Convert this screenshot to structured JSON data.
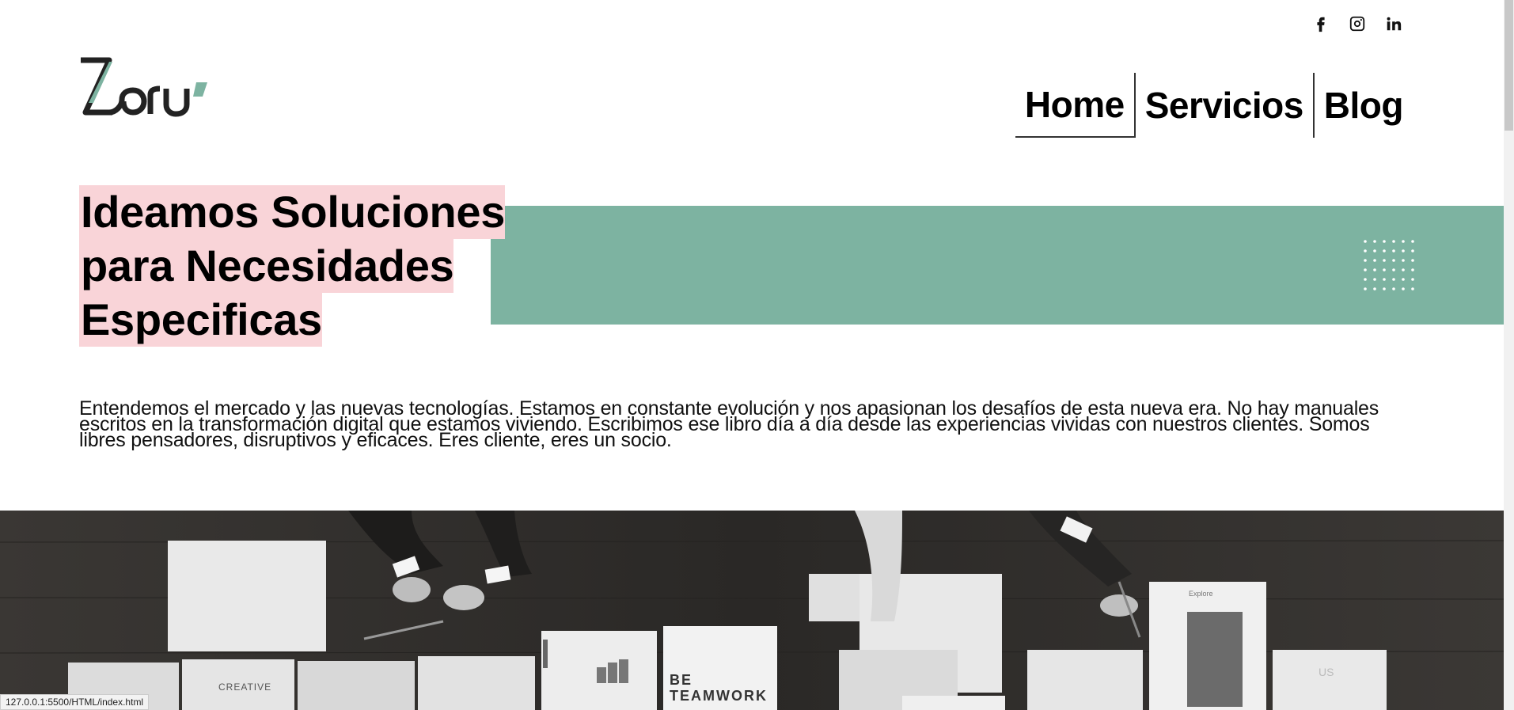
{
  "social": [
    {
      "name": "facebook-icon"
    },
    {
      "name": "instagram-icon"
    },
    {
      "name": "linkedin-icon"
    }
  ],
  "logo": {
    "text": "Zoru"
  },
  "nav": {
    "items": [
      {
        "label": "Home",
        "active": true
      },
      {
        "label": "Servicios",
        "active": false
      },
      {
        "label": "Blog",
        "active": false
      }
    ]
  },
  "hero": {
    "lines": [
      "Ideamos Soluciones",
      "para Necesidades",
      "Especificas"
    ]
  },
  "intro": {
    "line1": "Entendemos el mercado y las nuevas tecnologías. Estamos en constante evolución y nos apasionan los desafíos de esta nueva era. No hay manuales",
    "line2": "escritos en la transformación digital que estamos viviendo. Escribimos ese libro día a día desde las experiencias vividas con nuestros clientes. Somos",
    "line3": "libres pensadores, disruptivos y eficaces. Eres cliente, eres un socio."
  },
  "photo": {
    "card_creative": "CREATIVE",
    "card_teamwork_1": "BE",
    "card_teamwork_2": "TEAMWORK",
    "card_explore": "Explore",
    "card_us": "US"
  },
  "status_bar": {
    "url": "127.0.0.1:5500/HTML/index.html"
  },
  "colors": {
    "accent_green": "#7db3a1",
    "highlight_pink": "#f9d4d8"
  }
}
